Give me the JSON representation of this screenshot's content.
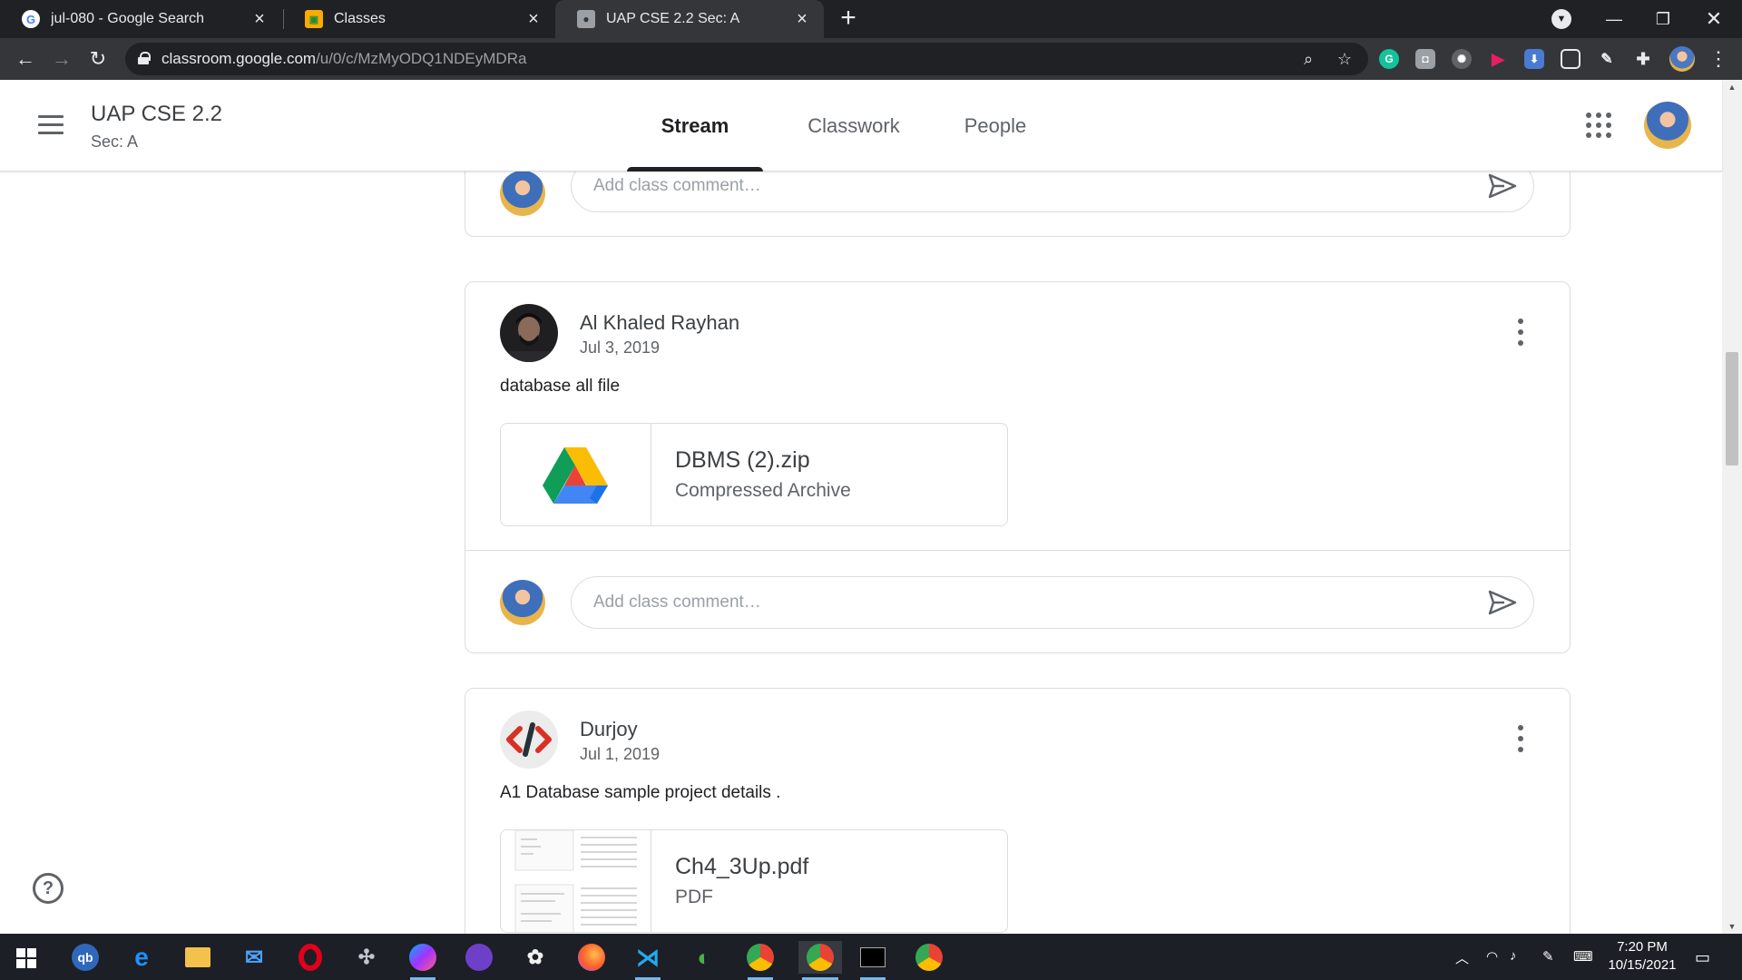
{
  "browser": {
    "tabs": [
      {
        "title": "jul-080 - Google Search",
        "favicon": "google-g-icon",
        "active": false
      },
      {
        "title": "Classes",
        "favicon": "classroom-icon",
        "active": false
      },
      {
        "title": "UAP CSE 2.2 Sec: A",
        "favicon": "classroom-class-icon",
        "active": true
      }
    ],
    "url_host": "classroom.google.com",
    "url_path": "/u/0/c/MzMyODQ1NDEyMDRa"
  },
  "header": {
    "class_name": "UAP CSE 2.2",
    "section": "Sec: A",
    "tabs": [
      {
        "label": "Stream",
        "active": true
      },
      {
        "label": "Classwork",
        "active": false
      },
      {
        "label": "People",
        "active": false
      }
    ]
  },
  "comment_placeholder": "Add class comment…",
  "posts": [
    {
      "author": "Al Khaled Rayhan",
      "date": "Jul 3, 2019",
      "text": "database all file",
      "attachment": {
        "name": "DBMS (2).zip",
        "type": "Compressed Archive",
        "thumb_icon": "google-drive-icon"
      }
    },
    {
      "author": "Durjoy",
      "date": "Jul 1, 2019",
      "text": "A1 Database sample project details .",
      "attachment": {
        "name": "Ch4_3Up.pdf",
        "type": "PDF",
        "thumb_icon": "pdf-preview"
      }
    }
  ],
  "taskbar": {
    "time": "7:20 PM",
    "date": "10/15/2021"
  },
  "colors": {
    "chrome_dark": "#202124",
    "chrome_toolbar": "#35363a",
    "text_primary": "#3c4043",
    "text_secondary": "#5f6368",
    "border": "#dadce0",
    "taskbar": "#1c1f26"
  }
}
